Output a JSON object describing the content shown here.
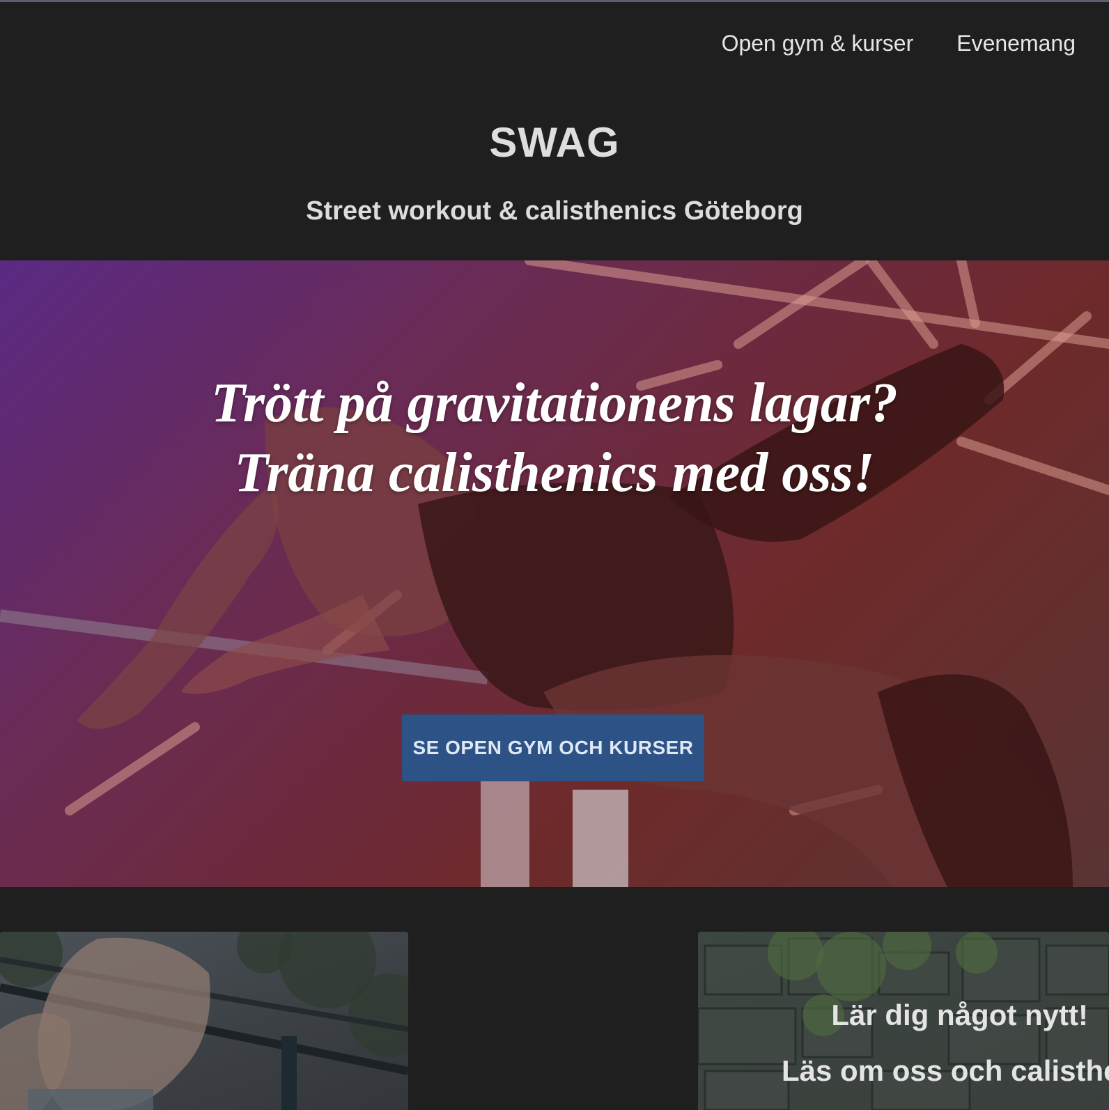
{
  "nav": {
    "items": [
      {
        "label": "Open gym & kurser"
      },
      {
        "label": "Evenemang"
      }
    ]
  },
  "header": {
    "brand": "SWAG",
    "tagline": "Street workout & calisthenics Göteborg"
  },
  "hero": {
    "headline_line1": "Trött på gravitationens lagar?",
    "headline_line2": "Träna calisthenics med oss!",
    "cta_label": "SE OPEN GYM OCH KURSER"
  },
  "cards": {
    "right_title": "Lär dig något nytt!",
    "right_subtitle": "Läs om oss och calisthen"
  },
  "colors": {
    "background": "#1f1f1f",
    "cta": "#2d5286"
  }
}
